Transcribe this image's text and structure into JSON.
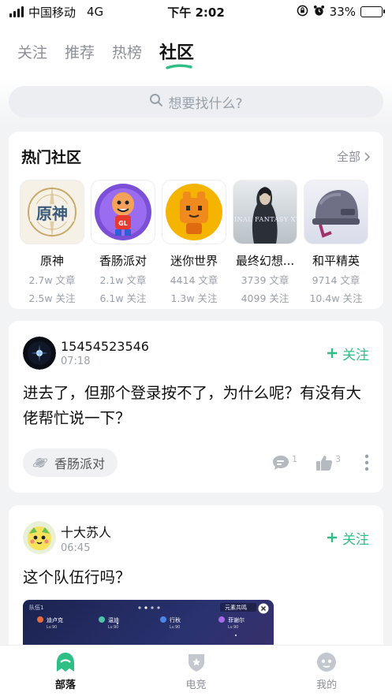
{
  "status_bar": {
    "carrier": "中国移动",
    "network": "4G",
    "time": "下午 2:02",
    "battery": "33%",
    "battery_level": 0.33
  },
  "top_tabs": [
    {
      "label": "关注",
      "active": false
    },
    {
      "label": "推荐",
      "active": false
    },
    {
      "label": "热榜",
      "active": false
    },
    {
      "label": "社区",
      "active": true
    }
  ],
  "search": {
    "placeholder": "想要找什么?"
  },
  "hot_communities": {
    "title": "热门社区",
    "all_label": "全部",
    "items": [
      {
        "name": "原神",
        "articles": "2.7w 文章",
        "followers": "2.5w 关注",
        "icon": "genshin-logo"
      },
      {
        "name": "香肠派对",
        "articles": "2.1w 文章",
        "followers": "6.1w 关注",
        "icon": "sausage-man-logo"
      },
      {
        "name": "迷你世界",
        "articles": "4414 文章",
        "followers": "1.3w 关注",
        "icon": "mini-world-logo"
      },
      {
        "name": "最终幻想...",
        "articles": "3739 文章",
        "followers": "4099 关注",
        "icon": "final-fantasy-logo"
      },
      {
        "name": "和平精英",
        "articles": "9714 文章",
        "followers": "10.4w 关注",
        "icon": "peacekeeper-elite-logo"
      }
    ]
  },
  "posts": [
    {
      "user": "15454523546",
      "time": "07:18",
      "follow_label": "关注",
      "text": "进去了，但那个登录按不了，为什么呢？有没有大佬帮忙说一下？",
      "community_tag": "香肠派对",
      "comments": "1",
      "likes": "3"
    },
    {
      "user": "十大苏人",
      "time": "06:45",
      "follow_label": "关注",
      "text": "这个队伍行吗？",
      "shot_labels": {
        "top_left": "队伍1",
        "top_right": "元素共鸣",
        "c1": "迪卢克",
        "c2": "温迪",
        "c3": "行秋",
        "c4": "菲谢尔",
        "level": "Lv.90"
      }
    }
  ],
  "bottom_nav": [
    {
      "label": "部落",
      "active": true
    },
    {
      "label": "电竞",
      "active": false
    },
    {
      "label": "我的",
      "active": false
    }
  ],
  "colors": {
    "accent": "#2fbf86"
  }
}
